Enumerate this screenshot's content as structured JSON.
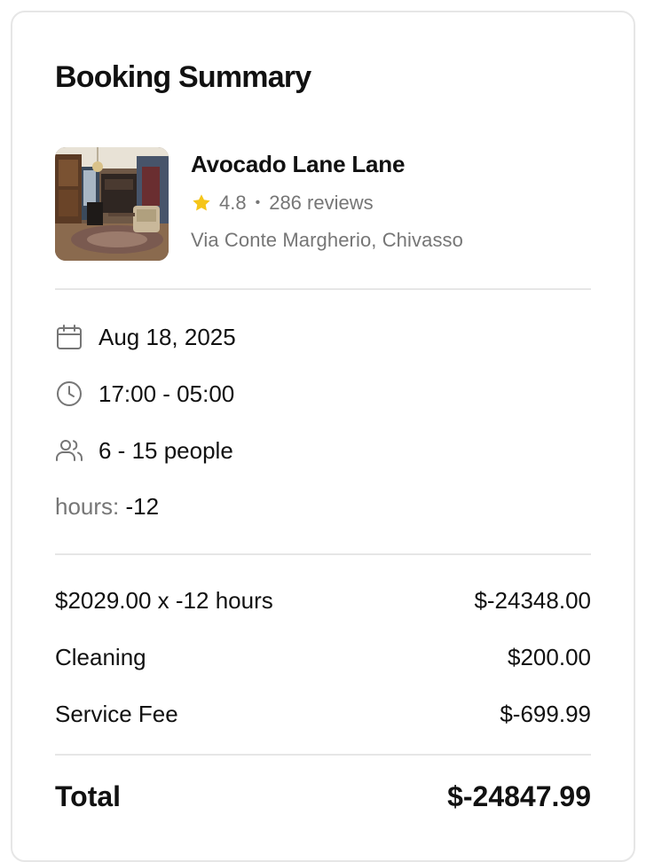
{
  "summary": {
    "title": "Booking Summary"
  },
  "venue": {
    "name": "Avocado Lane Lane",
    "rating": "4.8",
    "separator": "•",
    "reviews": "286 reviews",
    "address": "Via Conte Margherio, Chivasso",
    "rating_icon": "star-icon",
    "star_color": "#F5C518"
  },
  "details": {
    "date": "Aug 18, 2025",
    "time": "17:00 - 05:00",
    "guests": "6 - 15 people",
    "hours_label": "hours:",
    "hours_value": "-12"
  },
  "pricing": {
    "items": [
      {
        "label": "$2029.00 x -12 hours",
        "value": "$-24348.00"
      },
      {
        "label": "Cleaning",
        "value": "$200.00"
      },
      {
        "label": "Service Fee",
        "value": "$-699.99"
      }
    ],
    "total_label": "Total",
    "total_value": "$-24847.99"
  },
  "colors": {
    "text": "#111111",
    "muted": "#767676",
    "divider": "#E6E6E6",
    "border": "#E6E6E6"
  }
}
